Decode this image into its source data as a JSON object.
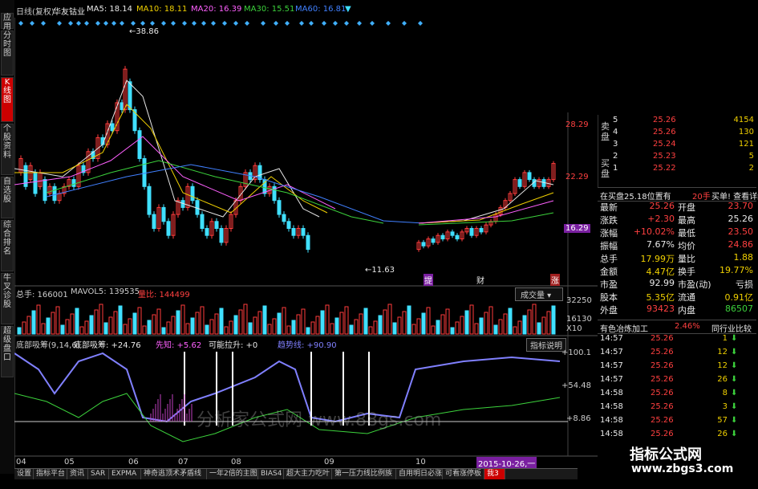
{
  "header": {
    "title": "日线(复权)",
    "stock": "华友钴业",
    "ma5": "MA5: 18.14",
    "ma10": "MA10: 18.11",
    "ma20": "MA20: 16.39",
    "ma30": "MA30: 15.51",
    "ma60": "MA60: 16.81"
  },
  "left_tabs": [
    "应用",
    "分时图",
    "K线图",
    "个股资料",
    "自选股",
    "综合排名",
    "牛叉诊股",
    "超级盘口"
  ],
  "price_axis": [
    "28.29",
    "22.29",
    "16.29"
  ],
  "annotations": {
    "high": "38.86",
    "low": "11.63",
    "m1": "提",
    "m2": "财",
    "m3": "涨"
  },
  "volume": {
    "total": "总手: 166001",
    "mavol": "MAVOL5: 139535",
    "ratio": "量比: 144499",
    "dropdown": "成交量",
    "axis": [
      "32250",
      "16130",
      "X10"
    ]
  },
  "indicator": {
    "name": "底部吸筹(9,14,6)",
    "v1": "底部吸筹: +24.76",
    "v2": "先知: +5.62",
    "v3": "可能拉升: +0",
    "v4": "趋势线: +90.90",
    "button": "指标说明",
    "axis": [
      "+100.1",
      "+54.48",
      "+8.86"
    ],
    "watermark": "分析家公式网 www.88gs.com"
  },
  "months": [
    "04",
    "05",
    "06",
    "07",
    "08",
    "09",
    "10"
  ],
  "date_badge": "2015-10-26,一",
  "order_book": {
    "sell_label": "卖盘",
    "buy_label": "买盘",
    "sell": [
      {
        "n": "5",
        "p": "25.26",
        "v": "4154"
      },
      {
        "n": "4",
        "p": "25.26",
        "v": "130"
      },
      {
        "n": "3",
        "p": "25.24",
        "v": "121"
      },
      {
        "n": "2",
        "p": "25.23",
        "v": "5"
      },
      {
        "n": "1",
        "p": "25.22",
        "v": "2"
      }
    ],
    "info": "在买盘25.18位置有",
    "info_qty": "20手",
    "info_link": "买单! 查看详细"
  },
  "quote": [
    {
      "l1": "最新",
      "v1": "25.26",
      "l2": "开盘",
      "v2": "23.70"
    },
    {
      "l1": "涨跌",
      "v1": "+2.30",
      "l2": "最高",
      "v2": "25.26"
    },
    {
      "l1": "涨幅",
      "v1": "+10.02%",
      "l2": "最低",
      "v2": "23.50"
    },
    {
      "l1": "振幅",
      "v1": "7.67%",
      "l2": "均价",
      "v2": "24.86"
    },
    {
      "l1": "总手",
      "v1": "17.99万",
      "l2": "量比",
      "v2": "1.88"
    },
    {
      "l1": "金额",
      "v1": "4.47亿",
      "l2": "换手",
      "v2": "19.77%"
    },
    {
      "l1": "市盈",
      "v1": "92.99",
      "l2": "市盈(动)",
      "v2": "亏损"
    },
    {
      "l1": "股本",
      "v1": "5.35亿",
      "l2": "流通",
      "v2": "0.91亿"
    },
    {
      "l1": "外盘",
      "v1": "93423",
      "l2": "内盘",
      "v2": "86507"
    }
  ],
  "sector": {
    "name": "有色冶炼加工",
    "pct": "2.46%",
    "button": "同行业比较"
  },
  "ticks": [
    {
      "t": "14:57",
      "p": "25.26",
      "v": "1"
    },
    {
      "t": "14:57",
      "p": "25.26",
      "v": "12"
    },
    {
      "t": "14:57",
      "p": "25.26",
      "v": "12"
    },
    {
      "t": "14:57",
      "p": "25.26",
      "v": "26"
    },
    {
      "t": "14:58",
      "p": "25.26",
      "v": "8"
    },
    {
      "t": "14:58",
      "p": "25.26",
      "v": "3"
    },
    {
      "t": "14:58",
      "p": "25.26",
      "v": "57"
    },
    {
      "t": "14:58",
      "p": "25.26",
      "v": "26"
    }
  ],
  "logo": {
    "title": "指标公式网",
    "url": "www.zbgs3.com"
  },
  "bottom_tabs": [
    "设置",
    "指标平台",
    "资讯",
    "SAR",
    "EXPMA",
    "神奇逃顶术矛盾线",
    "一年2倍的主图",
    "BIAS4",
    "超大主力吃叶",
    "第一压力线比例族",
    "自用明日必涨",
    "可看涨停板",
    "我3"
  ],
  "colors": {
    "up": "#ff3c3c",
    "down": "#40e0ff",
    "ma5": "#e8e8e8",
    "ma10": "#f0d000",
    "ma20": "#ff60ff",
    "ma30": "#3cd23c",
    "ma60": "#4080ff"
  }
}
